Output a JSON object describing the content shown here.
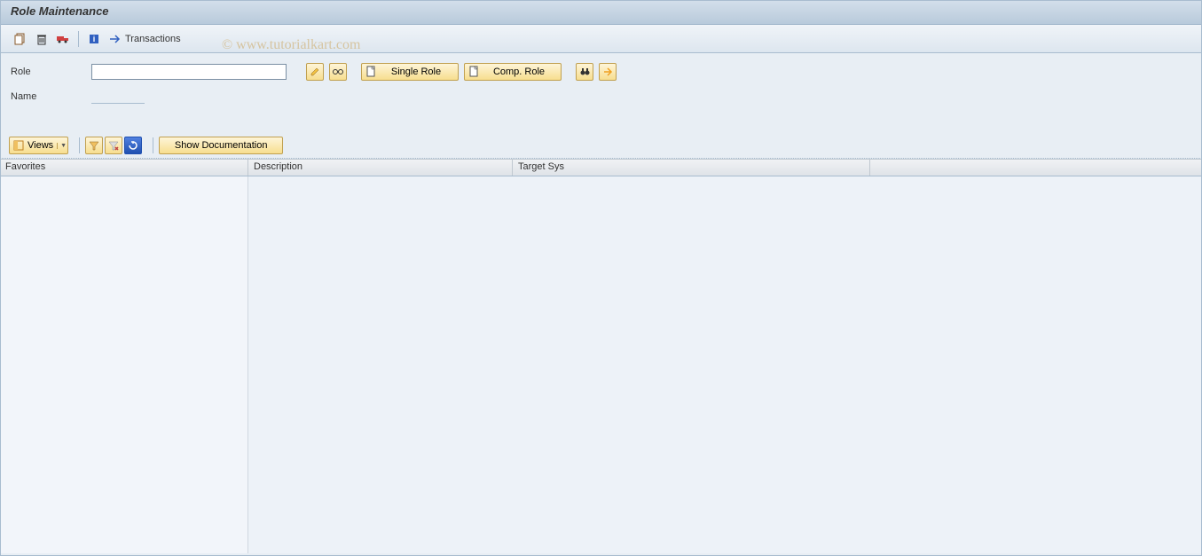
{
  "title": "Role Maintenance",
  "toolbar": {
    "transactions_label": "Transactions"
  },
  "form": {
    "role_label": "Role",
    "role_value": "",
    "name_label": "Name",
    "name_value": "",
    "single_role_label": "Single Role",
    "comp_role_label": "Comp. Role"
  },
  "lower_toolbar": {
    "views_label": "Views",
    "show_doc_label": "Show Documentation"
  },
  "grid": {
    "columns": {
      "favorites": "Favorites",
      "description": "Description",
      "target_sys": "Target Sys"
    },
    "rows": []
  },
  "watermark": "© www.tutorialkart.com",
  "icons": {
    "copy": "copy-icon",
    "delete": "delete-icon",
    "transport": "transport-icon",
    "info": "info-icon",
    "transactions": "transactions-icon",
    "edit": "edit-pencil-icon",
    "display": "glasses-icon",
    "new": "new-page-icon",
    "search": "binoculars-icon",
    "expand": "expand-icon",
    "views": "layout-icon",
    "filter": "filter-icon",
    "filter_delete": "filter-delete-icon",
    "refresh": "refresh-icon"
  }
}
